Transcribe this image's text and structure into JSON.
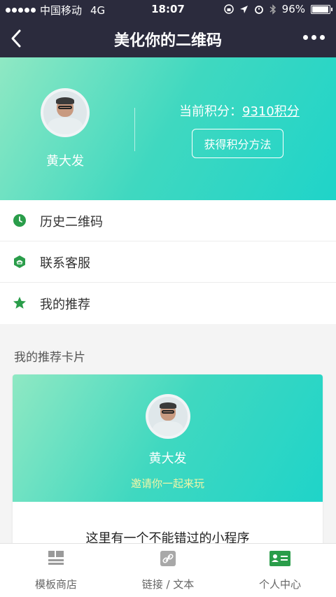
{
  "status_bar": {
    "carrier": "中国移动",
    "network": "4G",
    "time": "18:07",
    "battery": "96%"
  },
  "nav": {
    "title": "美化你的二维码"
  },
  "profile": {
    "name": "黄大发",
    "points_label": "当前积分：",
    "points_value": "9310积分",
    "earn_button": "获得积分方法"
  },
  "menu": [
    {
      "label": "历史二维码",
      "icon": "clock-icon"
    },
    {
      "label": "联系客服",
      "icon": "service-icon"
    },
    {
      "label": "我的推荐",
      "icon": "star-icon"
    }
  ],
  "recommend_section": {
    "title": "我的推荐卡片"
  },
  "card": {
    "name": "黄大发",
    "invite": "邀请你一起来玩",
    "text": "这里有一个不能错过的小程序"
  },
  "tabbar": [
    {
      "label": "模板商店",
      "icon": "template-store-icon"
    },
    {
      "label": "链接 / 文本",
      "icon": "link-icon"
    },
    {
      "label": "个人中心",
      "icon": "profile-card-icon"
    }
  ],
  "colors": {
    "header": "#2b2b3d",
    "accent_green": "#2a9d4a",
    "gradient_start": "#8fe8c3",
    "gradient_end": "#1fd4c9"
  }
}
